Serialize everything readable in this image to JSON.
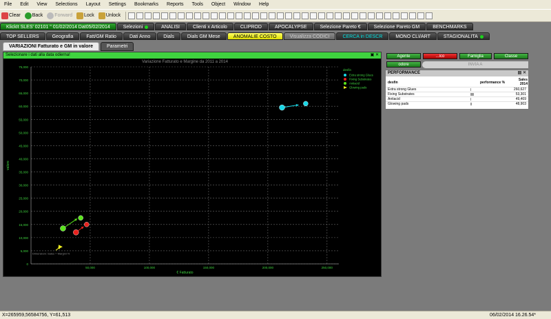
{
  "menu": [
    "File",
    "Edit",
    "View",
    "Selections",
    "Layout",
    "Settings",
    "Bookmarks",
    "Reports",
    "Tools",
    "Object",
    "Window",
    "Help"
  ],
  "toolbar": {
    "clear": "Clear",
    "back": "Back",
    "forward": "Forward",
    "lock": "Lock",
    "unlock": "Unlock"
  },
  "tabs_row1": [
    {
      "label": "KlickIt SLES' 02101 '' 01/02/2014  Dat05/02/2014",
      "style": "g"
    },
    {
      "label": "Selezioni",
      "style": "d",
      "dot": true
    },
    {
      "label": "ANALISI",
      "style": "d"
    },
    {
      "label": "Clienti x Articolo",
      "style": "d"
    },
    {
      "label": "CLIPROD",
      "style": "d"
    },
    {
      "label": "APOCALYPSE",
      "style": "d"
    },
    {
      "label": "Selezione Pareto €",
      "style": "d"
    },
    {
      "label": "Selezione Pareto GM",
      "style": "d"
    },
    {
      "label": "BENCHMARKS",
      "style": "d"
    }
  ],
  "tabs_row2": [
    {
      "label": "TOP SELLERS",
      "style": "d"
    },
    {
      "label": "Geografia",
      "style": "d"
    },
    {
      "label": "Fatt/GM Ratio",
      "style": "d"
    },
    {
      "label": "Dati Anno",
      "style": "d"
    },
    {
      "label": "Dials",
      "style": "d"
    },
    {
      "label": "Dials GM Mese",
      "style": "d"
    },
    {
      "label": "ANOMALIE COSTO",
      "style": "y"
    },
    {
      "label": "Visualizza CODICI",
      "style": "gray"
    },
    {
      "label": "CERCA in DESCR",
      "style": "cy"
    },
    {
      "label": "MONO CLI/ART",
      "style": "d"
    },
    {
      "label": "STAGIONALITA",
      "style": "d",
      "dot": true
    }
  ],
  "subtabs": [
    {
      "label": "VARIAZIONI Fatturato e GM in  valore",
      "active": true
    },
    {
      "label": "Parametri",
      "active": false
    }
  ],
  "chart_panel": {
    "header": "Selezionare i dati alla data odierna!"
  },
  "chart_data": {
    "type": "scatter",
    "title": "Variazione Fatturato e Margine da 2011 a 2014",
    "xlabel": "€ Fatturato",
    "ylabel": "valore",
    "legend_title": "desfin",
    "legend_position": "top-right",
    "xlim": [
      0,
      260000
    ],
    "ylim": [
      0,
      75000
    ],
    "x_ticks": [
      {
        "v": 50000,
        "label": "50,000"
      },
      {
        "v": 100000,
        "label": "100,000"
      },
      {
        "v": 150000,
        "label": "150,000"
      },
      {
        "v": 200000,
        "label": "200,000"
      },
      {
        "v": 250000,
        "label": "250,000"
      }
    ],
    "y_ticks": [
      0,
      5000,
      10000,
      15000,
      20000,
      25000,
      30000,
      35000,
      40000,
      45000,
      50000,
      55000,
      60000,
      65000,
      70000,
      75000
    ],
    "y_tick_labels": [
      "0",
      "5,000",
      "10,000",
      "15,000",
      "20,000",
      "25,000",
      "30,000",
      "35,000",
      "40,000",
      "45,000",
      "50,000",
      "55,000",
      "60,000",
      "65,000",
      "70,000",
      "75,000"
    ],
    "grid": true,
    "annotation": "Dimensioni: Sales  =  Margini %",
    "series": [
      {
        "name": "Extra strong Glues",
        "color": "#19d7e6",
        "marker": "circle",
        "points": [
          [
            232000,
            61000
          ],
          [
            212000,
            59500
          ]
        ],
        "arrow": [
          [
            212000,
            59500
          ],
          [
            226000,
            60500
          ]
        ]
      },
      {
        "name": "Fixing Substrates",
        "color": "#e8211d",
        "marker": "circle",
        "points": [
          [
            47000,
            15000
          ],
          [
            38000,
            12000
          ]
        ],
        "arrow": [
          [
            38000,
            12000
          ],
          [
            44500,
            14200
          ]
        ]
      },
      {
        "name": "Antiacid",
        "color": "#5ae51b",
        "marker": "circle",
        "points": [
          [
            42000,
            17500
          ],
          [
            27000,
            13500
          ]
        ],
        "arrow": [
          [
            27000,
            13500
          ],
          [
            39000,
            17200
          ]
        ]
      },
      {
        "name": "Glowing pads",
        "color": "#f0f020",
        "marker": "triangle",
        "points": [
          [
            25000,
            6500
          ]
        ],
        "arrow": [
          [
            21000,
            5200
          ],
          [
            25000,
            6500
          ]
        ]
      }
    ]
  },
  "right_buttons": [
    {
      "label": "Agente",
      "style": "g"
    },
    {
      "label": "...ico",
      "style": "red"
    },
    {
      "label": "Famiglia",
      "style": "g"
    },
    {
      "label": "Classe",
      "style": "g"
    }
  ],
  "odore_label": "odore",
  "invia_label": "INVIA A",
  "performance": {
    "title": "PERFORMANCE",
    "icons": "▤ ✕",
    "headers": {
      "name": "desfin",
      "perf": "performance %",
      "sales": "Sales 2014"
    },
    "rows": [
      {
        "name": "Extra strong Glues",
        "sales": "260,627",
        "pct": 1
      },
      {
        "name": "Fixing Substrates",
        "sales": "53,301",
        "pct": 10
      },
      {
        "name": "Antiacid",
        "sales": "49,469",
        "pct": 1
      },
      {
        "name": "Glowing pads",
        "sales": "48,903",
        "pct": 2
      }
    ]
  },
  "status": {
    "coords": "X=265959,56584756, Y=61,513",
    "datetime": "06/02/2014 16.26.54*"
  }
}
